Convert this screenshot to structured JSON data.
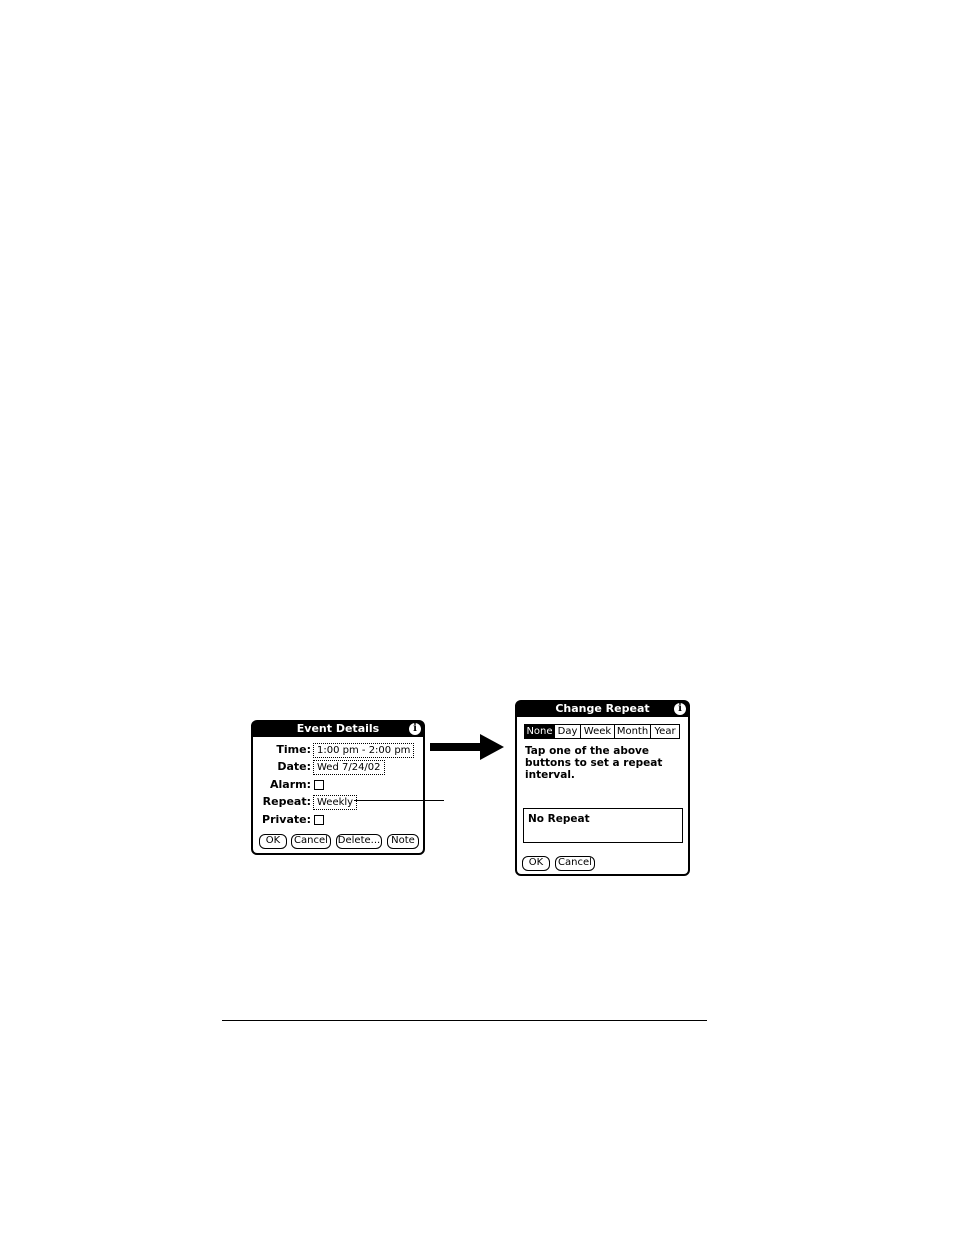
{
  "event_details": {
    "title": "Event Details",
    "info_icon": "i",
    "time_label": "Time:",
    "time_value": "1:00 pm - 2:00 pm",
    "date_label": "Date:",
    "date_value": "Wed 7/24/02",
    "alarm_label": "Alarm:",
    "repeat_label": "Repeat:",
    "repeat_value": "Weekly",
    "private_label": "Private:",
    "buttons": {
      "ok": "OK",
      "cancel": "Cancel",
      "delete": "Delete...",
      "note": "Note"
    }
  },
  "change_repeat": {
    "title": "Change Repeat",
    "info_icon": "i",
    "tabs": [
      "None",
      "Day",
      "Week",
      "Month",
      "Year"
    ],
    "selected_tab": "None",
    "instructions": [
      "Tap one of the above",
      "buttons to set a repeat",
      "interval."
    ],
    "result": "No Repeat",
    "buttons": {
      "ok": "OK",
      "cancel": "Cancel"
    }
  },
  "icons": {
    "arrow": "right-arrow-icon",
    "info": "info-icon"
  }
}
